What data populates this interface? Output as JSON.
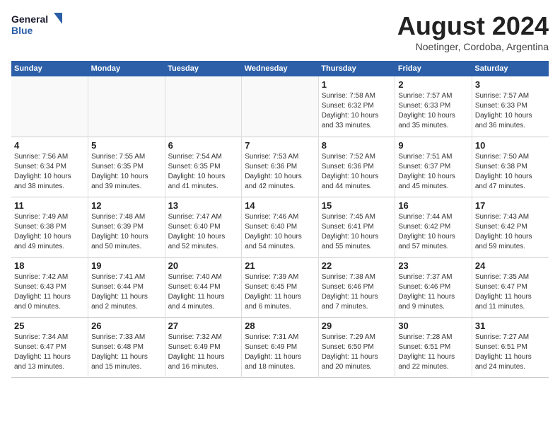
{
  "logo": {
    "line1": "General",
    "line2": "Blue"
  },
  "title": "August 2024",
  "location": "Noetinger, Cordoba, Argentina",
  "days_header": [
    "Sunday",
    "Monday",
    "Tuesday",
    "Wednesday",
    "Thursday",
    "Friday",
    "Saturday"
  ],
  "weeks": [
    [
      {
        "day": "",
        "info": ""
      },
      {
        "day": "",
        "info": ""
      },
      {
        "day": "",
        "info": ""
      },
      {
        "day": "",
        "info": ""
      },
      {
        "day": "1",
        "info": "Sunrise: 7:58 AM\nSunset: 6:32 PM\nDaylight: 10 hours\nand 33 minutes."
      },
      {
        "day": "2",
        "info": "Sunrise: 7:57 AM\nSunset: 6:33 PM\nDaylight: 10 hours\nand 35 minutes."
      },
      {
        "day": "3",
        "info": "Sunrise: 7:57 AM\nSunset: 6:33 PM\nDaylight: 10 hours\nand 36 minutes."
      }
    ],
    [
      {
        "day": "4",
        "info": "Sunrise: 7:56 AM\nSunset: 6:34 PM\nDaylight: 10 hours\nand 38 minutes."
      },
      {
        "day": "5",
        "info": "Sunrise: 7:55 AM\nSunset: 6:35 PM\nDaylight: 10 hours\nand 39 minutes."
      },
      {
        "day": "6",
        "info": "Sunrise: 7:54 AM\nSunset: 6:35 PM\nDaylight: 10 hours\nand 41 minutes."
      },
      {
        "day": "7",
        "info": "Sunrise: 7:53 AM\nSunset: 6:36 PM\nDaylight: 10 hours\nand 42 minutes."
      },
      {
        "day": "8",
        "info": "Sunrise: 7:52 AM\nSunset: 6:36 PM\nDaylight: 10 hours\nand 44 minutes."
      },
      {
        "day": "9",
        "info": "Sunrise: 7:51 AM\nSunset: 6:37 PM\nDaylight: 10 hours\nand 45 minutes."
      },
      {
        "day": "10",
        "info": "Sunrise: 7:50 AM\nSunset: 6:38 PM\nDaylight: 10 hours\nand 47 minutes."
      }
    ],
    [
      {
        "day": "11",
        "info": "Sunrise: 7:49 AM\nSunset: 6:38 PM\nDaylight: 10 hours\nand 49 minutes."
      },
      {
        "day": "12",
        "info": "Sunrise: 7:48 AM\nSunset: 6:39 PM\nDaylight: 10 hours\nand 50 minutes."
      },
      {
        "day": "13",
        "info": "Sunrise: 7:47 AM\nSunset: 6:40 PM\nDaylight: 10 hours\nand 52 minutes."
      },
      {
        "day": "14",
        "info": "Sunrise: 7:46 AM\nSunset: 6:40 PM\nDaylight: 10 hours\nand 54 minutes."
      },
      {
        "day": "15",
        "info": "Sunrise: 7:45 AM\nSunset: 6:41 PM\nDaylight: 10 hours\nand 55 minutes."
      },
      {
        "day": "16",
        "info": "Sunrise: 7:44 AM\nSunset: 6:42 PM\nDaylight: 10 hours\nand 57 minutes."
      },
      {
        "day": "17",
        "info": "Sunrise: 7:43 AM\nSunset: 6:42 PM\nDaylight: 10 hours\nand 59 minutes."
      }
    ],
    [
      {
        "day": "18",
        "info": "Sunrise: 7:42 AM\nSunset: 6:43 PM\nDaylight: 11 hours\nand 0 minutes."
      },
      {
        "day": "19",
        "info": "Sunrise: 7:41 AM\nSunset: 6:44 PM\nDaylight: 11 hours\nand 2 minutes."
      },
      {
        "day": "20",
        "info": "Sunrise: 7:40 AM\nSunset: 6:44 PM\nDaylight: 11 hours\nand 4 minutes."
      },
      {
        "day": "21",
        "info": "Sunrise: 7:39 AM\nSunset: 6:45 PM\nDaylight: 11 hours\nand 6 minutes."
      },
      {
        "day": "22",
        "info": "Sunrise: 7:38 AM\nSunset: 6:46 PM\nDaylight: 11 hours\nand 7 minutes."
      },
      {
        "day": "23",
        "info": "Sunrise: 7:37 AM\nSunset: 6:46 PM\nDaylight: 11 hours\nand 9 minutes."
      },
      {
        "day": "24",
        "info": "Sunrise: 7:35 AM\nSunset: 6:47 PM\nDaylight: 11 hours\nand 11 minutes."
      }
    ],
    [
      {
        "day": "25",
        "info": "Sunrise: 7:34 AM\nSunset: 6:47 PM\nDaylight: 11 hours\nand 13 minutes."
      },
      {
        "day": "26",
        "info": "Sunrise: 7:33 AM\nSunset: 6:48 PM\nDaylight: 11 hours\nand 15 minutes."
      },
      {
        "day": "27",
        "info": "Sunrise: 7:32 AM\nSunset: 6:49 PM\nDaylight: 11 hours\nand 16 minutes."
      },
      {
        "day": "28",
        "info": "Sunrise: 7:31 AM\nSunset: 6:49 PM\nDaylight: 11 hours\nand 18 minutes."
      },
      {
        "day": "29",
        "info": "Sunrise: 7:29 AM\nSunset: 6:50 PM\nDaylight: 11 hours\nand 20 minutes."
      },
      {
        "day": "30",
        "info": "Sunrise: 7:28 AM\nSunset: 6:51 PM\nDaylight: 11 hours\nand 22 minutes."
      },
      {
        "day": "31",
        "info": "Sunrise: 7:27 AM\nSunset: 6:51 PM\nDaylight: 11 hours\nand 24 minutes."
      }
    ]
  ]
}
